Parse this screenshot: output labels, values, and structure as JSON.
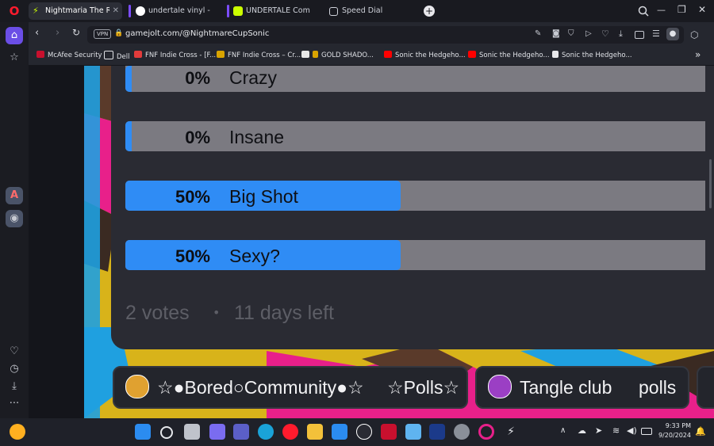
{
  "tabs": [
    {
      "label": "Nightmaria The Radio",
      "active": true,
      "close": "✕"
    },
    {
      "label": "undertale vinyl - Google S"
    },
    {
      "label": "UNDERTALE Complete Vin"
    },
    {
      "label": "Speed Dial"
    }
  ],
  "new_tab": "+",
  "window_controls": {
    "minimize": "—",
    "maximize": "❐",
    "close": "✕"
  },
  "address": {
    "vpn": "VPN",
    "url": "gamejolt.com/@NightmareCupSonic"
  },
  "bookmarks": [
    "McAfee Security",
    "Dell",
    "FNF Indie Cross - [F...",
    "FNF Indie Cross – Cr...",
    "GOLD SHADO...",
    "Sonic the Hedgeho...",
    "Sonic the Hedgeho...",
    "Sonic the Hedgeho..."
  ],
  "bookmarks_more": "»",
  "poll": {
    "options": [
      {
        "percent": "0%",
        "label": "Crazy",
        "fraction": 0.0
      },
      {
        "percent": "0%",
        "label": "Insane",
        "fraction": 0.0
      },
      {
        "percent": "50%",
        "label": "Big Shot",
        "fraction": 0.5
      },
      {
        "percent": "50%",
        "label": "Sexy?",
        "fraction": 0.5
      }
    ],
    "votes": "2 votes",
    "separator": "•",
    "time_left": "11 days left"
  },
  "communities": [
    {
      "name": "☆●Bored○Community●☆",
      "channel": "☆Polls☆"
    },
    {
      "name": "Tangle club",
      "channel": "polls"
    }
  ],
  "clock": {
    "time": "9:33 PM",
    "date": "9/20/2024"
  },
  "colors": {
    "accent": "#2f8cf5",
    "bar_bg": "#7b7a81",
    "card": "#2a2b33",
    "opera_red": "#ff1b2d"
  }
}
